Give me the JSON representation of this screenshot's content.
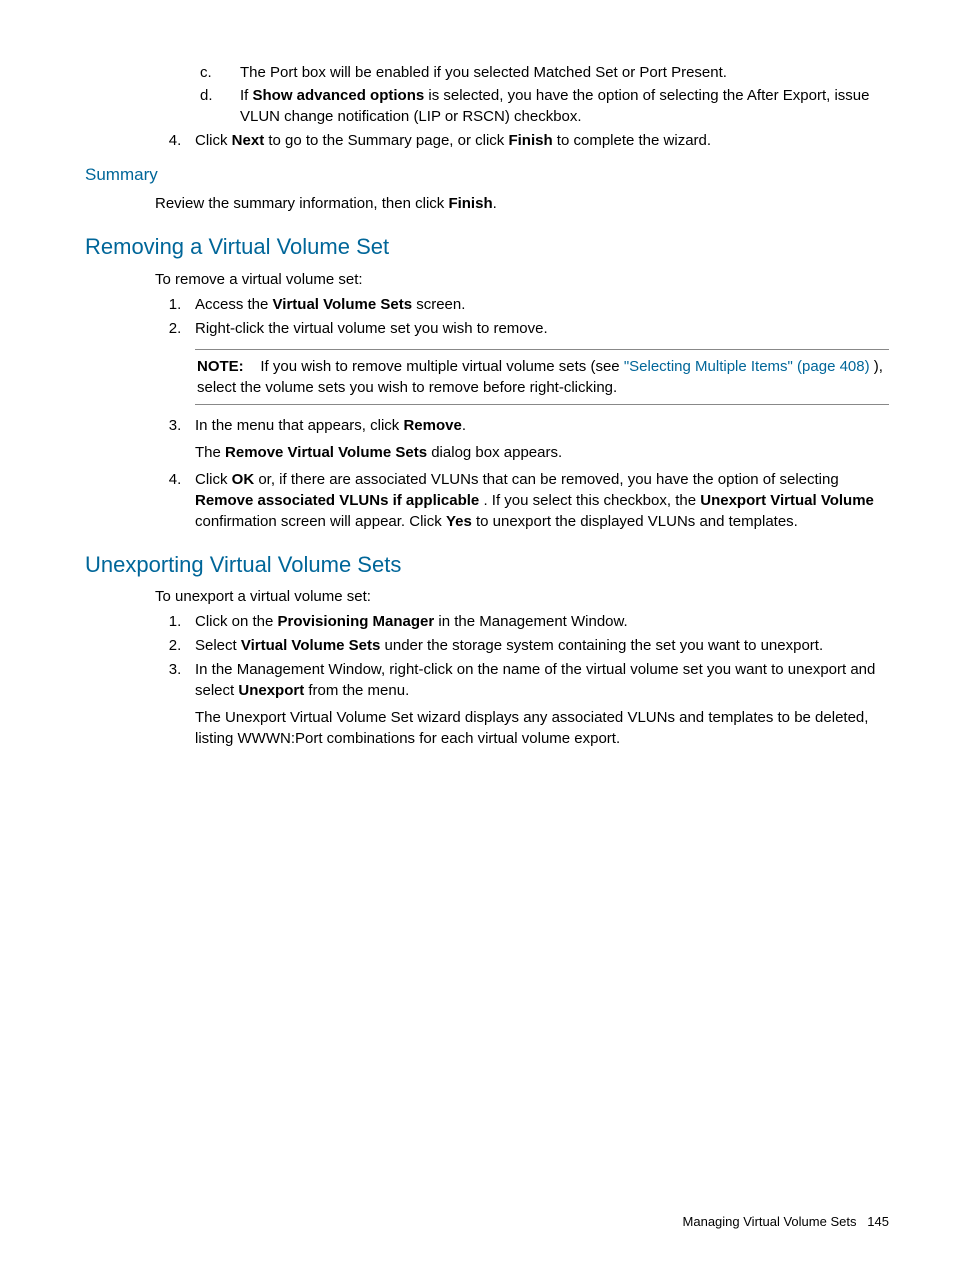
{
  "top": {
    "c_marker": "c.",
    "c_text": "The Port box will be enabled if you selected Matched Set or Port Present.",
    "d_marker": "d.",
    "d_pre": "If ",
    "d_bold1": "Show advanced options",
    "d_post": " is selected, you have the option of selecting the After Export, issue VLUN change notification (LIP or RSCN) checkbox.",
    "n4_marker": "4.",
    "n4_pre": "Click ",
    "n4_b1": "Next",
    "n4_mid": " to go to the Summary page, or click ",
    "n4_b2": "Finish",
    "n4_post": " to complete the wizard."
  },
  "summary": {
    "heading": "Summary",
    "text_pre": "Review the summary information, then click ",
    "text_bold": "Finish",
    "text_post": "."
  },
  "removing": {
    "heading": "Removing a Virtual Volume Set",
    "intro": "To remove a virtual volume set:",
    "s1_marker": "1.",
    "s1_pre": "Access the ",
    "s1_bold": "Virtual Volume Sets",
    "s1_post": " screen.",
    "s2_marker": "2.",
    "s2_text": "Right-click the virtual volume set you wish to remove.",
    "note_bold": "NOTE:",
    "note_pre": "If you wish to remove multiple virtual volume sets (see ",
    "note_link": "\"Selecting Multiple Items\" (page 408)",
    "note_post": " ), select the volume sets you wish to remove before right-clicking.",
    "s3_marker": "3.",
    "s3_pre": "In the menu that appears, click ",
    "s3_bold": "Remove",
    "s3_post": ".",
    "s3_sub_pre": "The ",
    "s3_sub_bold": "Remove Virtual Volume Sets",
    "s3_sub_post": " dialog box appears.",
    "s4_marker": "4.",
    "s4_pre": "Click ",
    "s4_b1": "OK",
    "s4_mid1": " or, if there are associated VLUNs that can be removed, you have the option of selecting ",
    "s4_b2": "Remove associated VLUNs if applicable",
    "s4_mid2": " . If you select this checkbox, the ",
    "s4_b3": "Unexport Virtual Volume",
    "s4_mid3": " confirmation screen will appear. Click ",
    "s4_b4": "Yes",
    "s4_post": " to unexport the displayed VLUNs and templates."
  },
  "unexporting": {
    "heading": "Unexporting Virtual Volume Sets",
    "intro": "To unexport a virtual volume set:",
    "s1_marker": "1.",
    "s1_pre": "Click on the ",
    "s1_bold": "Provisioning Manager",
    "s1_post": " in the Management Window.",
    "s2_marker": "2.",
    "s2_pre": "Select ",
    "s2_bold": "Virtual Volume Sets",
    "s2_post": " under the storage system containing the set you want to unexport.",
    "s3_marker": "3.",
    "s3_pre": "In the Management Window, right-click on the name of the virtual volume set you want to unexport and select ",
    "s3_bold": "Unexport",
    "s3_post": " from the menu.",
    "s3_sub": "The Unexport Virtual Volume Set wizard displays any associated VLUNs and templates to be deleted, listing WWWN:Port combinations for each virtual volume export."
  },
  "footer": {
    "text": "Managing Virtual Volume Sets",
    "page": "145"
  }
}
